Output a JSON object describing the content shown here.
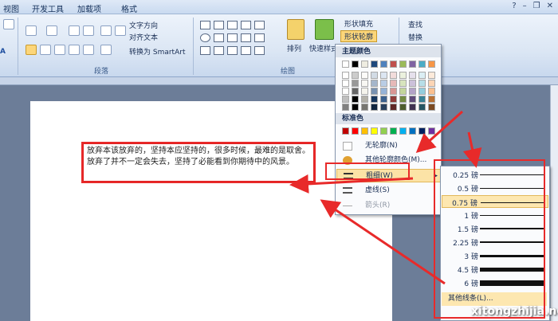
{
  "tabs": [
    "视图",
    "开发工具",
    "加载项",
    "格式"
  ],
  "ribbon": {
    "text_direction": "文字方向",
    "align_text": "对齐文本",
    "convert_smartart": "转换为 SmartArt",
    "paragraph_group": "段落",
    "drawing_group": "绘图",
    "arrange": "排列",
    "quick_styles": "快速样式",
    "shape_fill": "形状填充",
    "shape_outline": "形状轮廓",
    "find": "查找",
    "replace": "替换"
  },
  "document": {
    "textbox_text": "放弃本该放弃的，坚持本应坚持的，很多时候，最难的是取舍。放弃了并不一定会失去，坚持了必能看到你期待中的风景。"
  },
  "outline_menu": {
    "theme_colors_label": "主题颜色",
    "standard_colors_label": "标准色",
    "no_outline": "无轮廓(N)",
    "more_colors": "其他轮廓颜色(M)...",
    "weight": "粗细(W)",
    "dashes": "虚线(S)",
    "arrows": "箭头(R)"
  },
  "theme_colors": [
    "#ffffff",
    "#000000",
    "#eeece1",
    "#1f497d",
    "#4f81bd",
    "#c0504d",
    "#9bbb59",
    "#8064a2",
    "#4bacc6",
    "#f79646"
  ],
  "standard_colors": [
    "#c00000",
    "#ff0000",
    "#ffc000",
    "#ffff00",
    "#92d050",
    "#00b050",
    "#00b0f0",
    "#0070c0",
    "#002060",
    "#7030a0"
  ],
  "weights": [
    {
      "label": "0.25 磅",
      "thickness": 0.25
    },
    {
      "label": "0.5 磅",
      "thickness": 0.5
    },
    {
      "label": "0.75 磅",
      "thickness": 0.75
    },
    {
      "label": "1 磅",
      "thickness": 1
    },
    {
      "label": "1.5 磅",
      "thickness": 1.5
    },
    {
      "label": "2.25 磅",
      "thickness": 2.25
    },
    {
      "label": "3 磅",
      "thickness": 3
    },
    {
      "label": "4.5 磅",
      "thickness": 4.5
    },
    {
      "label": "6 磅",
      "thickness": 6
    }
  ],
  "selected_weight": "0.75 磅",
  "submenu_footer": "其他线条(L)...",
  "watermark": "xitongzhijia.net",
  "annotation_color": "#e82a2a"
}
